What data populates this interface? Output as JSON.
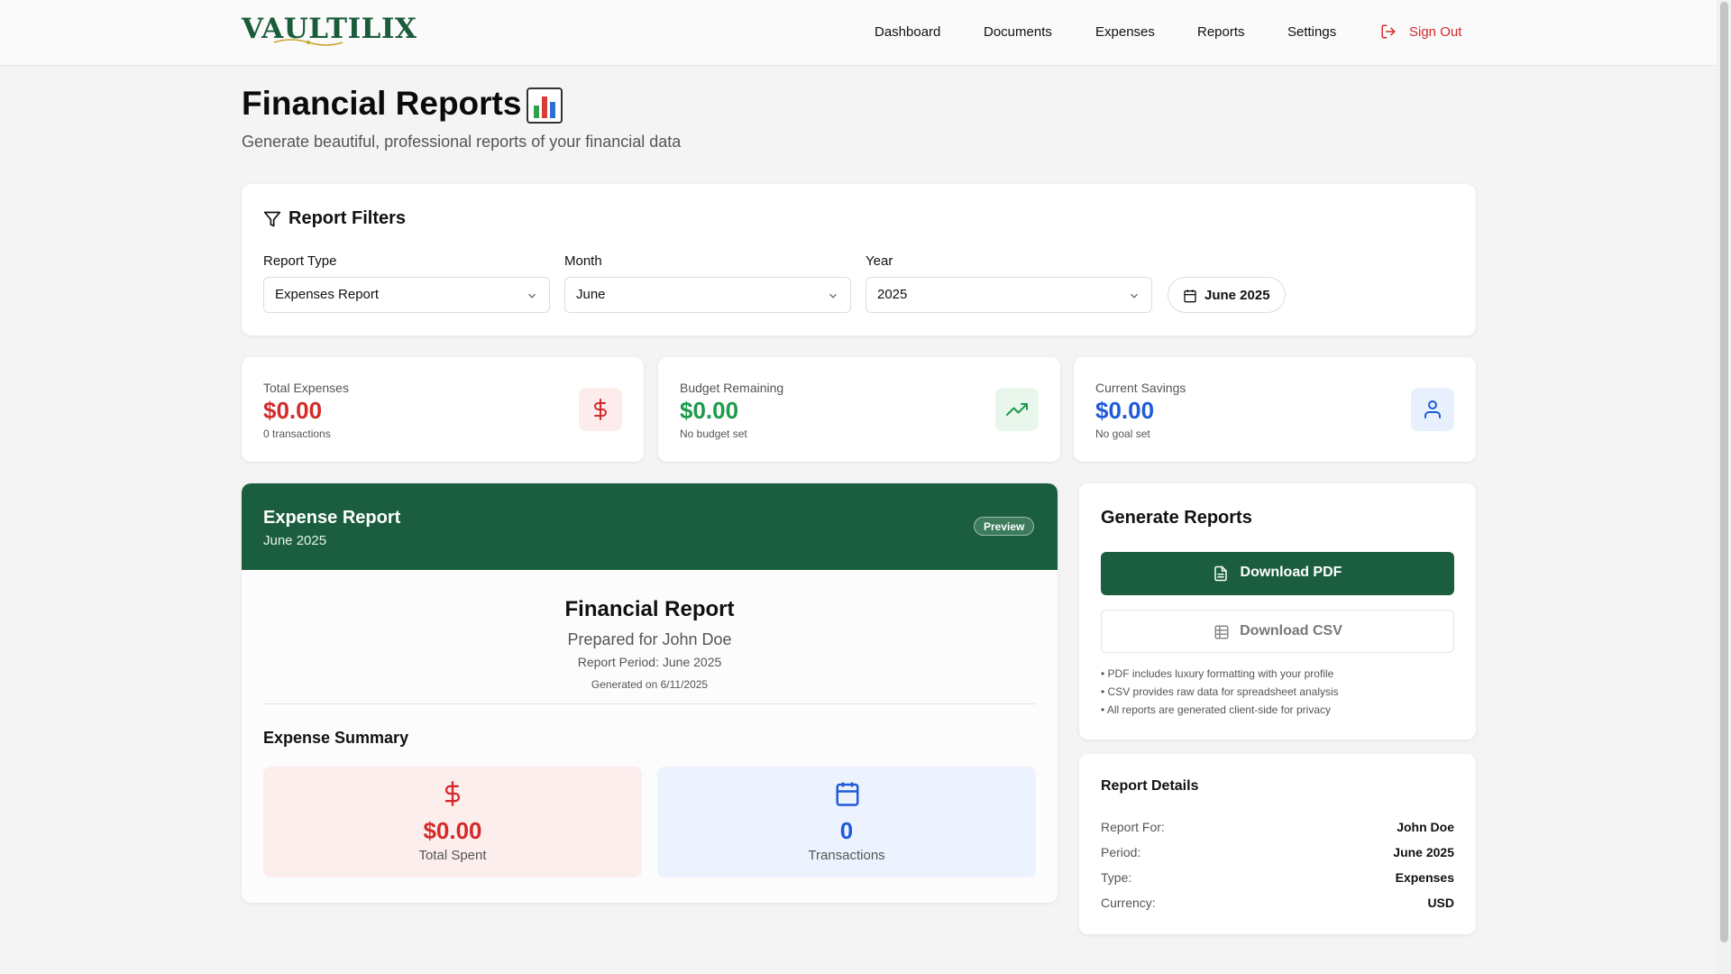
{
  "brand": {
    "logo": "VAULTILIX"
  },
  "nav": {
    "items": [
      "Dashboard",
      "Documents",
      "Expenses",
      "Reports",
      "Settings"
    ],
    "signout": "Sign Out"
  },
  "header": {
    "title": "Financial Reports",
    "subtitle": "Generate beautiful, professional reports of your financial data",
    "title_icon": "bar-chart-emoji"
  },
  "filters": {
    "title": "Report Filters",
    "report_type": {
      "label": "Report Type",
      "value": "Expenses Report"
    },
    "month": {
      "label": "Month",
      "value": "June"
    },
    "year": {
      "label": "Year",
      "value": "2025"
    },
    "period_chip": "June 2025"
  },
  "stats": [
    {
      "label": "Total Expenses",
      "value": "$0.00",
      "sub": "0 transactions",
      "color": "#d42a2a",
      "icon": "dollar-icon"
    },
    {
      "label": "Budget Remaining",
      "value": "$0.00",
      "sub": "No budget set",
      "color": "#1e9a4b",
      "icon": "trending-up-icon"
    },
    {
      "label": "Current Savings",
      "value": "$0.00",
      "sub": "No goal set",
      "color": "#1e5bd8",
      "icon": "user-icon"
    }
  ],
  "preview": {
    "title": "Expense Report",
    "subtitle": "June 2025",
    "badge": "Preview",
    "report_title": "Financial Report",
    "prepared_for": "Prepared for John Doe",
    "period": "Report Period: June 2025",
    "generated": "Generated on 6/11/2025",
    "summary_title": "Expense Summary",
    "summary": [
      {
        "value": "$0.00",
        "label": "Total Spent",
        "icon": "dollar-icon"
      },
      {
        "value": "0",
        "label": "Transactions",
        "icon": "calendar-icon"
      }
    ]
  },
  "generate": {
    "title": "Generate Reports",
    "pdf_label": "Download PDF",
    "csv_label": "Download CSV",
    "notes": [
      "• PDF includes luxury formatting with your profile",
      "• CSV provides raw data for spreadsheet analysis",
      "• All reports are generated client-side for privacy"
    ]
  },
  "details": {
    "title": "Report Details",
    "rows": [
      {
        "key": "Report For:",
        "value": "John Doe"
      },
      {
        "key": "Period:",
        "value": "June 2025"
      },
      {
        "key": "Type:",
        "value": "Expenses"
      },
      {
        "key": "Currency:",
        "value": "USD"
      }
    ]
  },
  "colors": {
    "brand_green": "#1b5e3f",
    "danger_red": "#d42a2a",
    "success_green": "#1e9a4b",
    "info_blue": "#1e5bd8"
  }
}
